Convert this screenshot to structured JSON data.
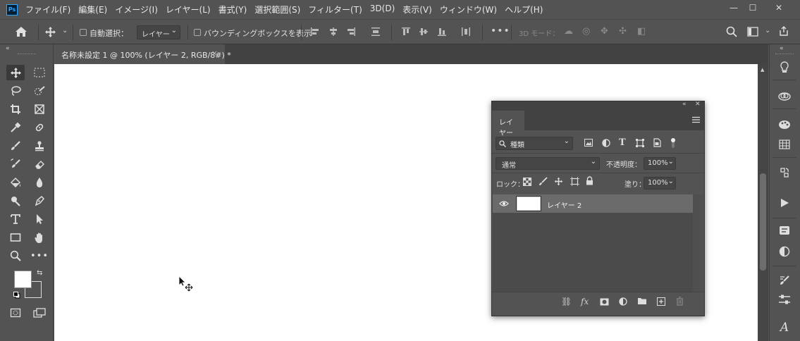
{
  "app": {
    "logo": "Ps"
  },
  "menu": [
    "ファイル(F)",
    "編集(E)",
    "イメージ(I)",
    "レイヤー(L)",
    "書式(Y)",
    "選択範囲(S)",
    "フィルター(T)",
    "3D(D)",
    "表示(V)",
    "ウィンドウ(W)",
    "ヘルプ(H)"
  ],
  "window_controls": {
    "minimize": "—",
    "maximize": "☐",
    "close": "✕"
  },
  "options": {
    "auto_select_label": "自動選択：",
    "auto_select_value": "レイヤー",
    "bbox_label": "バウンディングボックスを表示",
    "mode_3d_label": "3D モード："
  },
  "document": {
    "tab_title": "名称未設定 1 @ 100% (レイヤー 2, RGB/8#) *",
    "tab_close": "×"
  },
  "layers_panel": {
    "tab_label": "レイヤー",
    "filter_label": "種類",
    "blend_mode": "通常",
    "opacity_label": "不透明度：",
    "opacity_value": "100%",
    "lock_label": "ロック：",
    "fill_label": "塗り：",
    "fill_value": "100%",
    "layers": [
      {
        "name": "レイヤー 2",
        "visible": true,
        "selected": true
      }
    ]
  },
  "tool_colors": {
    "foreground": "#ffffff",
    "background": "#535353"
  },
  "icons": [
    "home-icon",
    "move-icon",
    "marquee-icon",
    "lasso-icon",
    "quick-select-icon",
    "crop-icon",
    "frame-icon",
    "eyedropper-icon",
    "healing-icon",
    "brush-icon",
    "stamp-icon",
    "history-brush-icon",
    "eraser-icon",
    "bucket-icon",
    "blur-icon",
    "dodge-icon",
    "pen-icon",
    "type-icon",
    "path-select-icon",
    "rectangle-icon",
    "hand-icon",
    "zoom-icon",
    "more-tools-icon",
    "search-icon",
    "workspace-icon",
    "share-icon"
  ]
}
